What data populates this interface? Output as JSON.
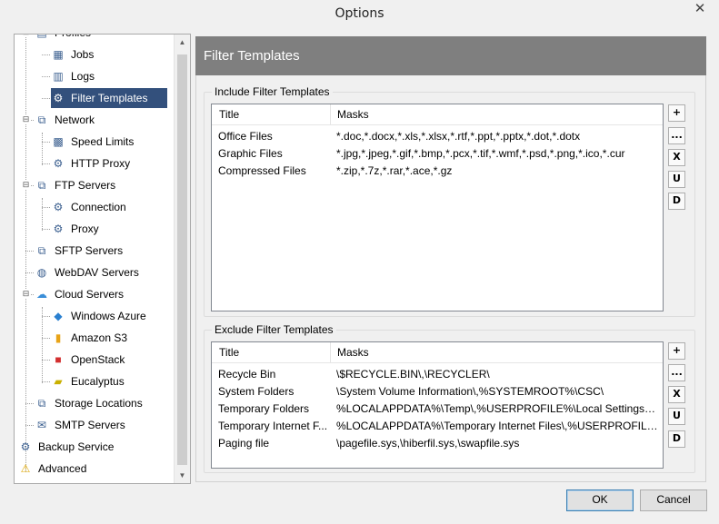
{
  "window": {
    "title": "Options",
    "close_glyph": "✕"
  },
  "tree": {
    "items": [
      {
        "label": "Profiles",
        "icon": "profiles-icon",
        "glyph": "▤"
      },
      {
        "label": "Jobs",
        "icon": "jobs-icon",
        "glyph": "▦"
      },
      {
        "label": "Logs",
        "icon": "logs-icon",
        "glyph": "▥"
      },
      {
        "label": "Filter Templates",
        "icon": "filter-templates-icon",
        "glyph": "⚙"
      },
      {
        "label": "Network",
        "icon": "network-icon",
        "glyph": "⧉"
      },
      {
        "label": "Speed Limits",
        "icon": "speed-limits-icon",
        "glyph": "▩"
      },
      {
        "label": "HTTP Proxy",
        "icon": "http-proxy-icon",
        "glyph": "⚙"
      },
      {
        "label": "FTP Servers",
        "icon": "ftp-servers-icon",
        "glyph": "⧉"
      },
      {
        "label": "Connection",
        "icon": "connection-icon",
        "glyph": "⚙"
      },
      {
        "label": "Proxy",
        "icon": "proxy-icon",
        "glyph": "⚙"
      },
      {
        "label": "SFTP Servers",
        "icon": "sftp-servers-icon",
        "glyph": "⧉"
      },
      {
        "label": "WebDAV Servers",
        "icon": "webdav-servers-icon",
        "glyph": "◍"
      },
      {
        "label": "Cloud Servers",
        "icon": "cloud-servers-icon",
        "glyph": "☁"
      },
      {
        "label": "Windows Azure",
        "icon": "windows-azure-icon",
        "glyph": "◆"
      },
      {
        "label": "Amazon S3",
        "icon": "amazon-s3-icon",
        "glyph": "▮"
      },
      {
        "label": "OpenStack",
        "icon": "openstack-icon",
        "glyph": "■"
      },
      {
        "label": "Eucalyptus",
        "icon": "eucalyptus-icon",
        "glyph": "▰"
      },
      {
        "label": "Storage Locations",
        "icon": "storage-locations-icon",
        "glyph": "⧉"
      },
      {
        "label": "SMTP Servers",
        "icon": "smtp-servers-icon",
        "glyph": "✉"
      },
      {
        "label": "Backup Service",
        "icon": "backup-service-icon",
        "glyph": "⚙"
      },
      {
        "label": "Advanced",
        "icon": "advanced-warning-icon",
        "glyph": "⚠"
      }
    ],
    "expander_glyph": "⊟",
    "scroll_up": "▲",
    "scroll_down": "▼"
  },
  "panel": {
    "title": "Filter Templates",
    "include": {
      "legend": "Include Filter Templates",
      "columns": [
        "Title",
        "Masks"
      ],
      "rows": [
        [
          "Office Files",
          "*.doc,*.docx,*.xls,*.xlsx,*.rtf,*.ppt,*.pptx,*.dot,*.dotx"
        ],
        [
          "Graphic Files",
          "*.jpg,*.jpeg,*.gif,*.bmp,*.pcx,*.tif,*.wmf,*.psd,*.png,*.ico,*.cur"
        ],
        [
          "Compressed Files",
          "*.zip,*.7z,*.rar,*.ace,*.gz"
        ]
      ]
    },
    "exclude": {
      "legend": "Exclude Filter Templates",
      "columns": [
        "Title",
        "Masks"
      ],
      "rows": [
        [
          "Recycle Bin",
          "\\$RECYCLE.BIN\\,\\RECYCLER\\"
        ],
        [
          "System Folders",
          "\\System Volume Information\\,%SYSTEMROOT%\\CSC\\"
        ],
        [
          "Temporary Folders",
          "%LOCALAPPDATA%\\Temp\\,%USERPROFILE%\\Local Settings\\Te..."
        ],
        [
          "Temporary Internet F...",
          "%LOCALAPPDATA%\\Temporary Internet Files\\,%USERPROFILE%..."
        ],
        [
          "Paging file",
          "\\pagefile.sys,\\hiberfil.sys,\\swapfile.sys"
        ]
      ]
    },
    "side_buttons": {
      "add": "+",
      "edit": "...",
      "delete": "X",
      "up": "U",
      "down": "D"
    }
  },
  "footer": {
    "ok": "OK",
    "cancel": "Cancel"
  }
}
